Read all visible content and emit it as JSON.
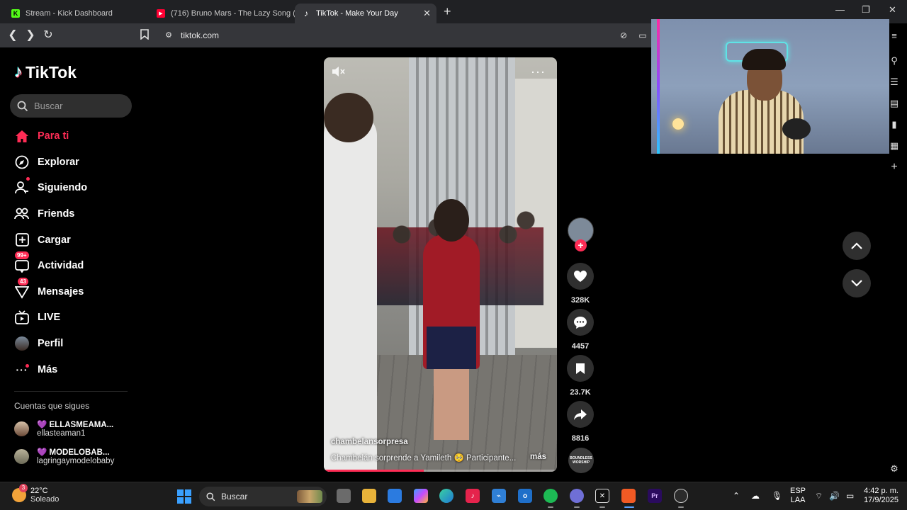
{
  "browser": {
    "tabs": [
      {
        "label": "Stream - Kick Dashboard",
        "favicon_color": "#53fc18",
        "favicon_glyph": "K"
      },
      {
        "label": "(716) Bruno Mars - The Lazy Song (O",
        "favicon_color": "#ff0033",
        "favicon_glyph": "▶"
      },
      {
        "label": "TikTok - Make Your Day",
        "favicon_color": "#000000",
        "favicon_glyph": "♪"
      }
    ],
    "active_tab_index": 2,
    "url": "tiktok.com"
  },
  "tiktok": {
    "logo_text": "TikTok",
    "search_placeholder": "Buscar",
    "accent_color": "#fe2c55",
    "menu": [
      {
        "label": "Para ti",
        "icon": "home-icon",
        "active": true
      },
      {
        "label": "Explorar",
        "icon": "compass-icon"
      },
      {
        "label": "Siguiendo",
        "icon": "following-icon"
      },
      {
        "label": "Friends",
        "icon": "friends-icon"
      },
      {
        "label": "Cargar",
        "icon": "upload-icon"
      },
      {
        "label": "Actividad",
        "icon": "activity-icon",
        "badge": "99+"
      },
      {
        "label": "Mensajes",
        "icon": "messages-icon",
        "badge": "43"
      },
      {
        "label": "LIVE",
        "icon": "live-icon"
      },
      {
        "label": "Perfil",
        "icon": "profile-avatar"
      },
      {
        "label": "Más",
        "icon": "more-icon"
      }
    ],
    "following_title": "Cuentas que sigues",
    "following": [
      {
        "display": "💜 ELLASMEAMA...",
        "handle": "ellasteaman1"
      },
      {
        "display": "💜 MODELOBAB...",
        "handle": "lagringaymodelobaby"
      }
    ],
    "video": {
      "author": "chambelansorpresa",
      "caption": "Chambelán sorprende a Yamileth 🥺  Participante...",
      "more_label": "más",
      "progress": 0.43
    },
    "actions": {
      "likes": "328K",
      "comments": "4457",
      "saves": "23.7K",
      "shares": "8816"
    },
    "sound_label": "BOUNDLESS WORSHIP"
  },
  "taskbar": {
    "weather_temp": "22°C",
    "weather_desc": "Soleado",
    "weather_badge": "3",
    "search_label": "Buscar",
    "lang_line1": "ESP",
    "lang_line2": "LAA",
    "time": "4:42 p. m.",
    "date": "17/9/2025"
  }
}
